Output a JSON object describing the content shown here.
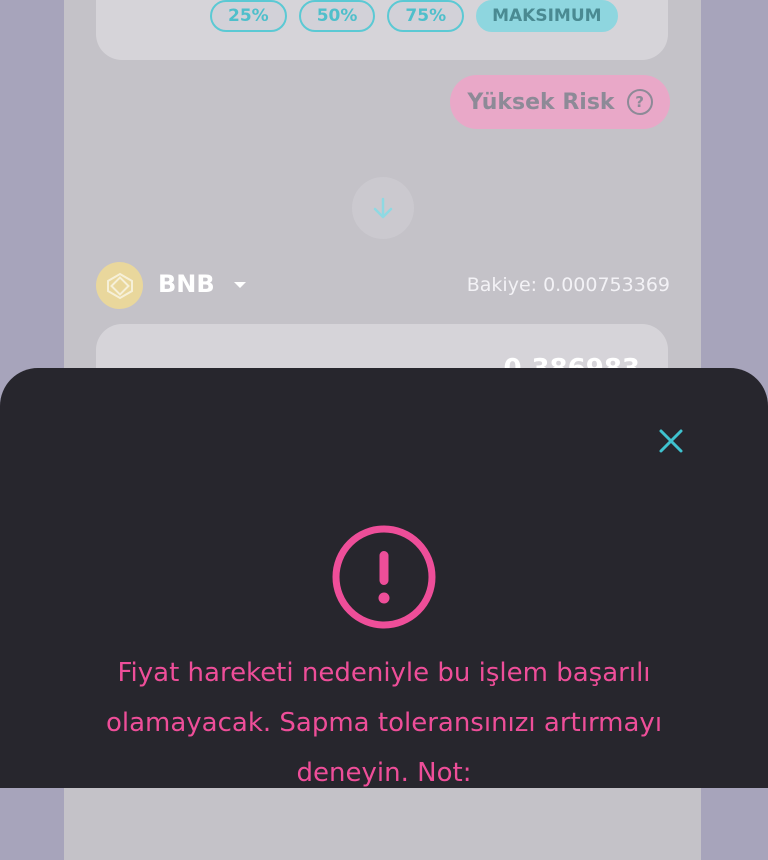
{
  "percent_buttons": [
    "25%",
    "50%",
    "75%",
    "MAKSIMUM"
  ],
  "risk": {
    "label": "Yüksek Risk",
    "help_symbol": "?"
  },
  "token": {
    "name": "BNB",
    "balance": "Bakiye: 0.000753369"
  },
  "output": {
    "amount": "0.386983"
  },
  "modal": {
    "message": "Fiyat hareketi nedeniyle bu işlem başarılı olamayacak. Sapma toleransınızı artırmayı deneyin. Not:"
  },
  "colors": {
    "accent_teal": "#4fbfcb",
    "warning_pink": "#ee4e99",
    "modal_bg": "#27262d",
    "overlay_bg": "#a7a4bb"
  },
  "icons": [
    "arrow-down-icon",
    "bnb-logo-icon",
    "chevron-down-icon",
    "close-icon",
    "warning-icon",
    "help-icon"
  ]
}
